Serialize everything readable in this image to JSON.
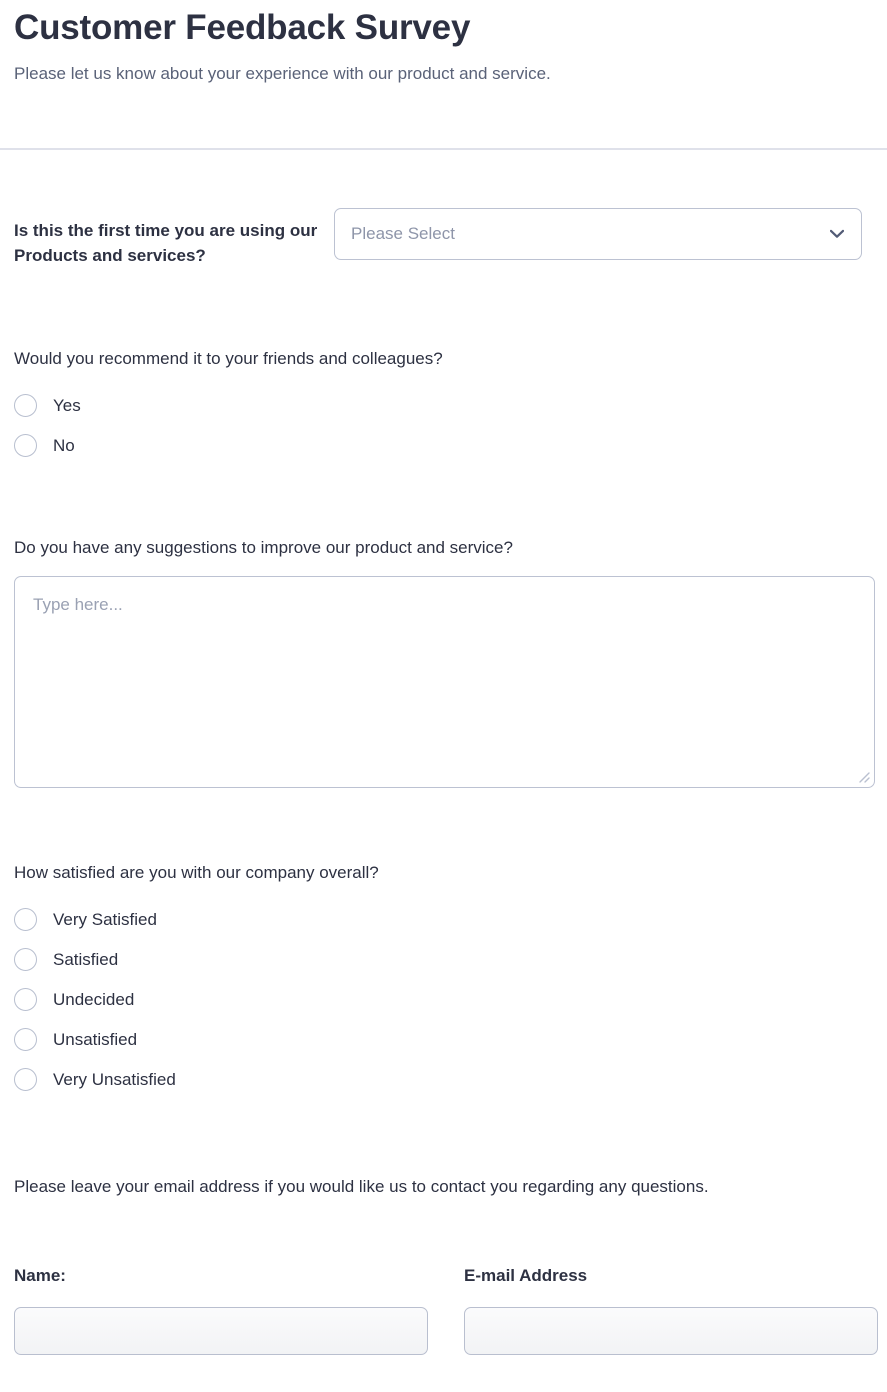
{
  "header": {
    "title": "Customer Feedback Survey",
    "subtitle": "Please let us know about your experience with our product and service."
  },
  "colors": {
    "text_dark": "#2d3142",
    "text_muted": "#5a6278",
    "placeholder": "#8e95a9",
    "border": "#bcc2d2",
    "page_background": "#ffffff",
    "outer_background": "#eeeeee"
  },
  "questions": {
    "first_time": {
      "label": "Is this the first time you are using our Products and services?",
      "select_placeholder": "Please Select",
      "select_value": "",
      "chevron_icon": "chevron-down-icon"
    },
    "recommend": {
      "label": "Would you recommend it to your friends and colleagues?",
      "options": [
        {
          "label": "Yes",
          "selected": false
        },
        {
          "label": "No",
          "selected": false
        }
      ]
    },
    "suggestions": {
      "label": "Do you have any suggestions to improve our product and service?",
      "placeholder": "Type here...",
      "value": "",
      "resize_icon": "resize-grip-icon"
    },
    "satisfaction": {
      "label": "How satisfied are you with our company overall?",
      "options": [
        {
          "label": "Very Satisfied",
          "selected": false
        },
        {
          "label": "Satisfied",
          "selected": false
        },
        {
          "label": "Undecided",
          "selected": false
        },
        {
          "label": "Unsatisfied",
          "selected": false
        },
        {
          "label": "Very Unsatisfied",
          "selected": false
        }
      ]
    },
    "contact": {
      "note": "Please leave your email address if you would like us to contact you regarding any questions.",
      "name_label": "Name:",
      "name_value": "",
      "email_label": "E-mail Address",
      "email_value": ""
    }
  }
}
